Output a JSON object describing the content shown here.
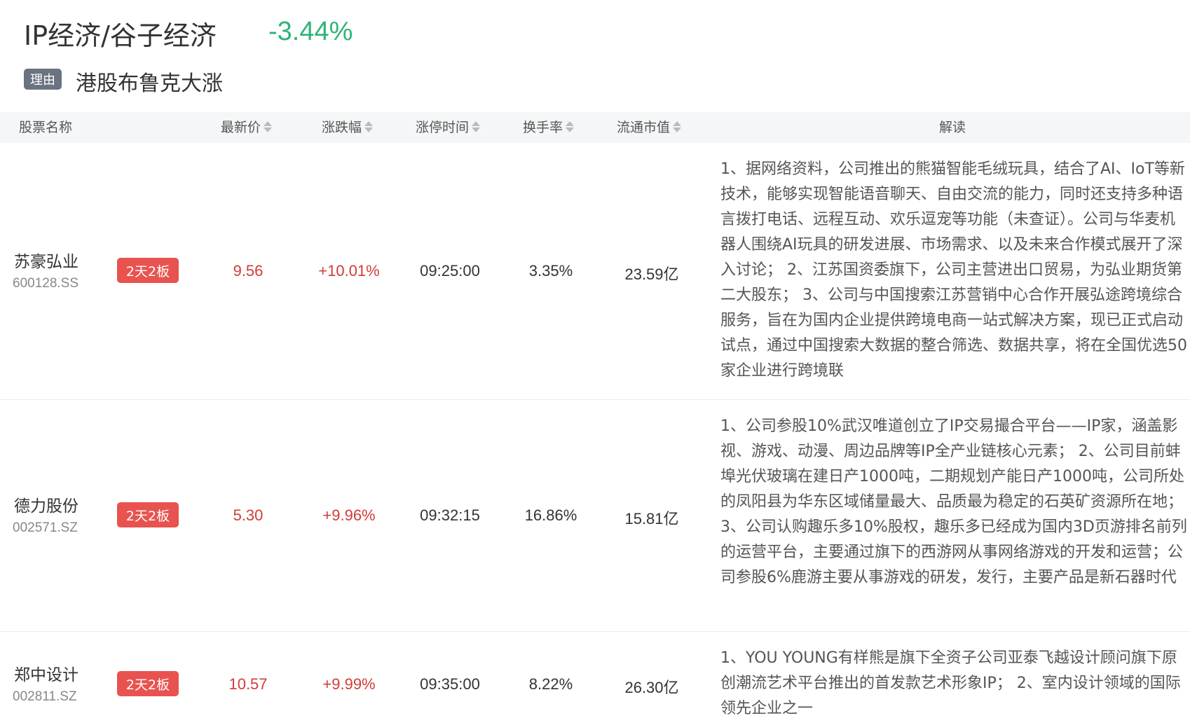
{
  "header": {
    "title": "IP经济/谷子经济",
    "change": "-3.44%",
    "reason_tag": "理由",
    "reason_text": "港股布鲁克大涨"
  },
  "table": {
    "columns": [
      "股票名称",
      "最新价",
      "涨跌幅",
      "涨停时间",
      "换手率",
      "流通市值",
      "解读"
    ],
    "rows": [
      {
        "name": "苏豪弘业",
        "code": "600128.SS",
        "badge": "2天2板",
        "price": "9.56",
        "change": "+10.01%",
        "limit_time": "09:25:00",
        "turnover": "3.35%",
        "market_cap": "23.59亿",
        "description": "1、据网络资料，公司推出的熊猫智能毛绒玩具，结合了AI、IoT等新技术，能够实现智能语音聊天、自由交流的能力，同时还支持多种语言拨打电话、远程互动、欢乐逗宠等功能（未查证）。公司与华麦机器人围绕AI玩具的研发进展、市场需求、以及未来合作模式展开了深入讨论； 2、江苏国资委旗下，公司主营进出口贸易，为弘业期货第二大股东； 3、公司与中国搜索江苏营销中心合作开展弘途跨境综合服务，旨在为国内企业提供跨境电商一站式解决方案，现已正式启动试点，通过中国搜索大数据的整合筛选、数据共享，将在全国优选50家企业进行跨境联"
      },
      {
        "name": "德力股份",
        "code": "002571.SZ",
        "badge": "2天2板",
        "price": "5.30",
        "change": "+9.96%",
        "limit_time": "09:32:15",
        "turnover": "16.86%",
        "market_cap": "15.81亿",
        "description": "1、公司参股10%武汉唯道创立了IP交易撮合平台——IP家，涵盖影视、游戏、动漫、周边品牌等IP全产业链核心元素； 2、公司目前蚌埠光伏玻璃在建日产1000吨，二期规划产能日产1000吨，公司所处的凤阳县为华东区域储量最大、品质最为稳定的石英矿资源所在地； 3、公司认购趣乐多10%股权，趣乐多已经成为国内3D页游排名前列的运营平台，主要通过旗下的西游网从事网络游戏的开发和运营；公司参股6%鹿游主要从事游戏的研发，发行，主要产品是新石器时代"
      },
      {
        "name": "郑中设计",
        "code": "002811.SZ",
        "badge": "2天2板",
        "price": "10.57",
        "change": "+9.99%",
        "limit_time": "09:35:00",
        "turnover": "8.22%",
        "market_cap": "26.30亿",
        "description": "1、YOU YOUNG有样熊是旗下全资子公司亚泰飞越设计顾问旗下原创潮流艺术平台推出的首发款艺术形象IP； 2、室内设计领域的国际领先企业之一"
      }
    ]
  }
}
